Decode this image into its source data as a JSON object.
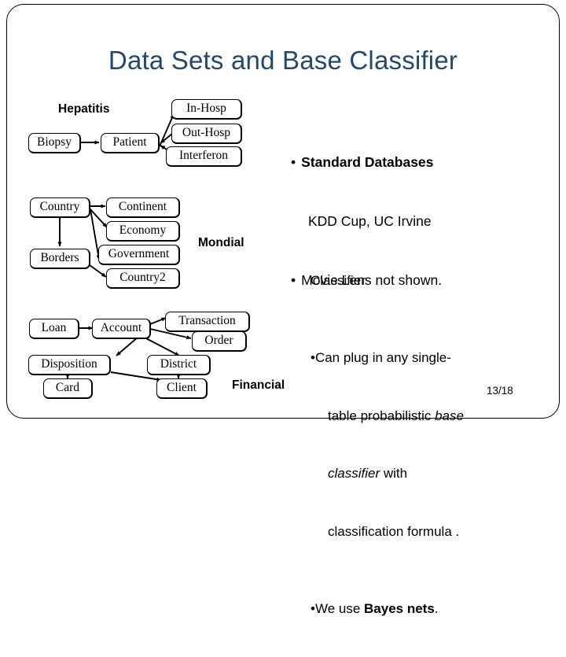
{
  "slide": {
    "title": "Data Sets and Base Classifier",
    "page_number": "13/18",
    "accent_color": "#23496f"
  },
  "diagrams": [
    {
      "name": "hepatitis",
      "caption": "Hepatitis",
      "nodes": [
        {
          "id": "biopsy",
          "label": "Biopsy"
        },
        {
          "id": "patient",
          "label": "Patient"
        },
        {
          "id": "in-hosp",
          "label": "In-Hosp"
        },
        {
          "id": "out-hosp",
          "label": "Out-Hosp"
        },
        {
          "id": "interferon",
          "label": "Interferon"
        }
      ],
      "edges": [
        {
          "from": "biopsy",
          "to": "patient"
        },
        {
          "from": "patient",
          "to": "in-hosp"
        },
        {
          "from": "out-hosp",
          "to": "patient"
        },
        {
          "from": "interferon",
          "to": "patient"
        }
      ]
    },
    {
      "name": "mondial",
      "caption": "Mondial",
      "nodes": [
        {
          "id": "country",
          "label": "Country"
        },
        {
          "id": "continent",
          "label": "Continent"
        },
        {
          "id": "economy",
          "label": "Economy"
        },
        {
          "id": "borders",
          "label": "Borders"
        },
        {
          "id": "government",
          "label": "Government"
        },
        {
          "id": "country2",
          "label": "Country2"
        }
      ],
      "edges": [
        {
          "from": "country",
          "to": "continent"
        },
        {
          "from": "country",
          "to": "economy"
        },
        {
          "from": "country",
          "to": "borders"
        },
        {
          "from": "country",
          "to": "government"
        },
        {
          "from": "borders",
          "to": "country2"
        }
      ]
    },
    {
      "name": "financial",
      "caption": "Financial",
      "nodes": [
        {
          "id": "loan",
          "label": "Loan"
        },
        {
          "id": "account",
          "label": "Account"
        },
        {
          "id": "transaction",
          "label": "Transaction"
        },
        {
          "id": "order",
          "label": "Order"
        },
        {
          "id": "disposition",
          "label": "Disposition"
        },
        {
          "id": "district",
          "label": "District"
        },
        {
          "id": "card",
          "label": "Card"
        },
        {
          "id": "client",
          "label": "Client"
        }
      ],
      "edges": [
        {
          "from": "loan",
          "to": "account"
        },
        {
          "from": "account",
          "to": "transaction"
        },
        {
          "from": "account",
          "to": "order"
        },
        {
          "from": "account",
          "to": "disposition"
        },
        {
          "from": "account",
          "to": "district"
        },
        {
          "from": "disposition",
          "to": "card"
        },
        {
          "from": "disposition",
          "to": "client"
        },
        {
          "from": "district",
          "to": "client"
        }
      ]
    }
  ],
  "databases_block": {
    "bullet_glyph": "•",
    "item1_bold": "Standard Databases",
    "item1_second_line": "KDD Cup, UC Irvine",
    "item2": "Movie.Lens not shown."
  },
  "classifier_block": {
    "bullet_glyph": "•",
    "heading": "Classifier",
    "item1_part1": "Can plug in any single-",
    "item1_part2": "table probabilistic ",
    "item1_italic1": "base",
    "item1_part3": "classifier",
    "item1_part4": " with",
    "item1_part5": "classification formula .",
    "item2_pre": "We use ",
    "item2_bold": "Bayes nets",
    "item2_post": "."
  }
}
